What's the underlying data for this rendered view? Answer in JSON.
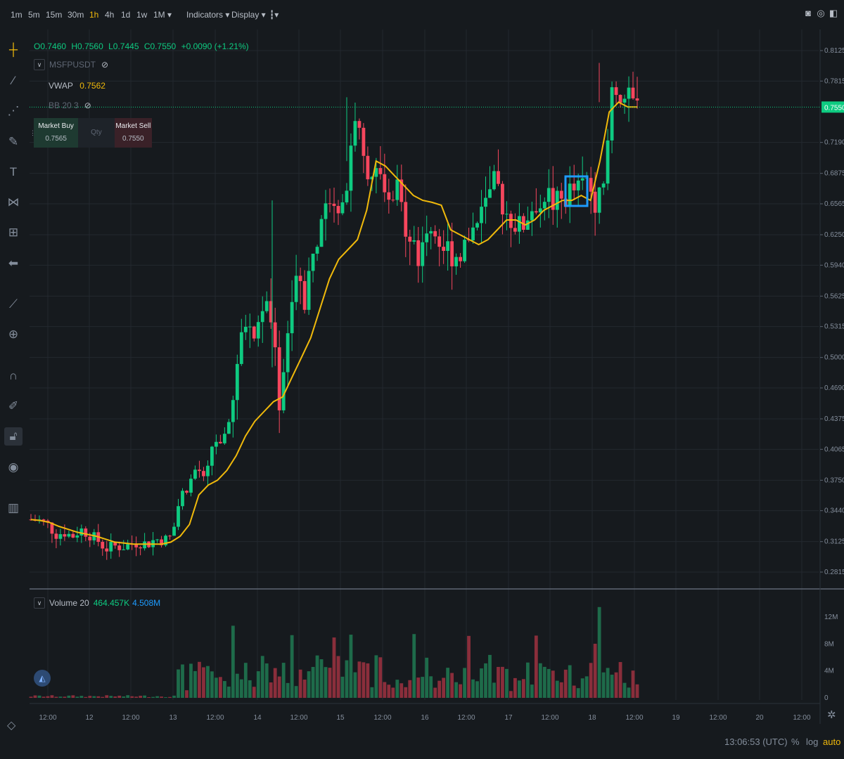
{
  "timeframes": [
    "1m",
    "5m",
    "15m",
    "30m",
    "1h",
    "4h",
    "1d",
    "1w",
    "1M"
  ],
  "active_timeframe": "1h",
  "toolbar": {
    "more_label": "▾",
    "indicators_label": "Indicators ▾",
    "display_label": "Display ▾",
    "chart_type_label": "▾"
  },
  "legend": {
    "open": "O0.7460",
    "high": "H0.7560",
    "low": "L0.7445",
    "close": "C0.7550",
    "change": "+0.0090 (+1.21%)",
    "symbol": "MSFPUSDT",
    "vwap_label": "VWAP",
    "vwap_value": "0.7562",
    "bb_label": "BB 20 3"
  },
  "order_panel": {
    "buy_label": "Market Buy",
    "buy_price": "0.7565",
    "qty_label": "Qty",
    "sell_label": "Market Sell",
    "sell_price": "0.7550"
  },
  "volume_legend": {
    "label": "Volume 20",
    "value1": "464.457K",
    "value2": "4.508M"
  },
  "price_axis": [
    "0.8125",
    "0.7815",
    "0.7190",
    "0.6875",
    "0.6565",
    "0.6250",
    "0.5940",
    "0.5625",
    "0.5315",
    "0.5000",
    "0.4690",
    "0.4375",
    "0.4065",
    "0.3750",
    "0.3440",
    "0.3125",
    "0.2815"
  ],
  "last_price_label": "0.7550",
  "volume_axis": [
    "12M",
    "8M",
    "4M",
    "0"
  ],
  "time_axis": [
    "12:00",
    "12",
    "12:00",
    "13",
    "12:00",
    "14",
    "12:00",
    "15",
    "12:00",
    "16",
    "12:00",
    "17",
    "12:00",
    "18",
    "12:00",
    "19",
    "12:00",
    "20",
    "12:00"
  ],
  "footer": {
    "time": "13:06:53 (UTC)",
    "percent_label": "%",
    "log_label": "log",
    "auto_label": "auto"
  },
  "colors": {
    "up": "#0ecb81",
    "down": "#f6465d",
    "vwap": "#f0b90b",
    "highlight": "#1e9cff",
    "background": "#161a1e",
    "grid": "#23282f"
  },
  "chart_data": {
    "type": "candlestick",
    "symbol": "MSFPUSDT",
    "interval": "1h",
    "y_range": [
      0.27,
      0.83
    ],
    "x_ticks": [
      "12:00",
      "12",
      "12:00",
      "13",
      "12:00",
      "14",
      "12:00",
      "15",
      "12:00",
      "16",
      "12:00",
      "17",
      "12:00",
      "18",
      "12:00",
      "19",
      "12:00",
      "20",
      "12:00"
    ],
    "close_path": [
      0.335,
      0.334,
      0.33,
      0.32,
      0.322,
      0.318,
      0.325,
      0.32,
      0.314,
      0.305,
      0.308,
      0.307,
      0.31,
      0.312,
      0.31,
      0.315,
      0.314,
      0.318,
      0.36,
      0.37,
      0.39,
      0.37,
      0.42,
      0.405,
      0.44,
      0.5,
      0.54,
      0.52,
      0.56,
      0.53,
      0.45,
      0.53,
      0.6,
      0.56,
      0.62,
      0.63,
      0.67,
      0.66,
      0.68,
      0.75,
      0.7,
      0.69,
      0.68,
      0.65,
      0.67,
      0.64,
      0.62,
      0.6,
      0.64,
      0.62,
      0.61,
      0.605,
      0.61,
      0.63,
      0.64,
      0.66,
      0.68,
      0.65,
      0.64,
      0.63,
      0.65,
      0.66,
      0.67,
      0.655,
      0.66,
      0.67,
      0.67,
      0.68,
      0.66,
      0.67,
      0.78,
      0.77,
      0.76,
      0.755
    ],
    "vwap_path": [
      0.335,
      0.334,
      0.332,
      0.328,
      0.325,
      0.322,
      0.32,
      0.318,
      0.315,
      0.312,
      0.311,
      0.31,
      0.31,
      0.31,
      0.31,
      0.312,
      0.318,
      0.33,
      0.36,
      0.37,
      0.375,
      0.385,
      0.4,
      0.42,
      0.435,
      0.445,
      0.455,
      0.46,
      0.48,
      0.5,
      0.52,
      0.55,
      0.58,
      0.6,
      0.61,
      0.62,
      0.65,
      0.7,
      0.695,
      0.685,
      0.675,
      0.665,
      0.66,
      0.658,
      0.655,
      0.63,
      0.625,
      0.62,
      0.615,
      0.62,
      0.63,
      0.64,
      0.64,
      0.635,
      0.64,
      0.65,
      0.655,
      0.66,
      0.66,
      0.665,
      0.66,
      0.7,
      0.75,
      0.76,
      0.755,
      0.755
    ],
    "volume_range": [
      0,
      14
    ],
    "volume_unit": "M",
    "annotation": "blue highlight box"
  }
}
